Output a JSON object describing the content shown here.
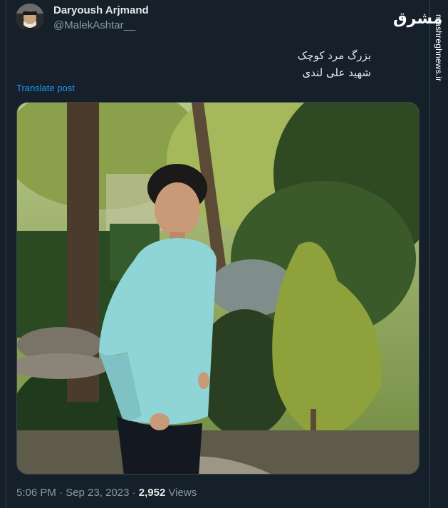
{
  "author": {
    "name": "Daryoush Arjmand",
    "handle": "@MalekAshtar__",
    "avatar_icon": "profile-photo"
  },
  "tweet": {
    "lines": [
      "بزرگ مرد کوچک",
      "شهید علی لندی"
    ],
    "translate_label": "Translate post"
  },
  "meta": {
    "time_date": "5:06 PM · Sep 23, 2023 · ",
    "views_count": "2,952",
    "views_label": " Views"
  },
  "watermark": {
    "logo": "مشرق",
    "url": "mashreghnews.ir"
  },
  "colors": {
    "background": "#15202b",
    "link": "#1d9bf0",
    "secondary_text": "#8b98a5"
  }
}
